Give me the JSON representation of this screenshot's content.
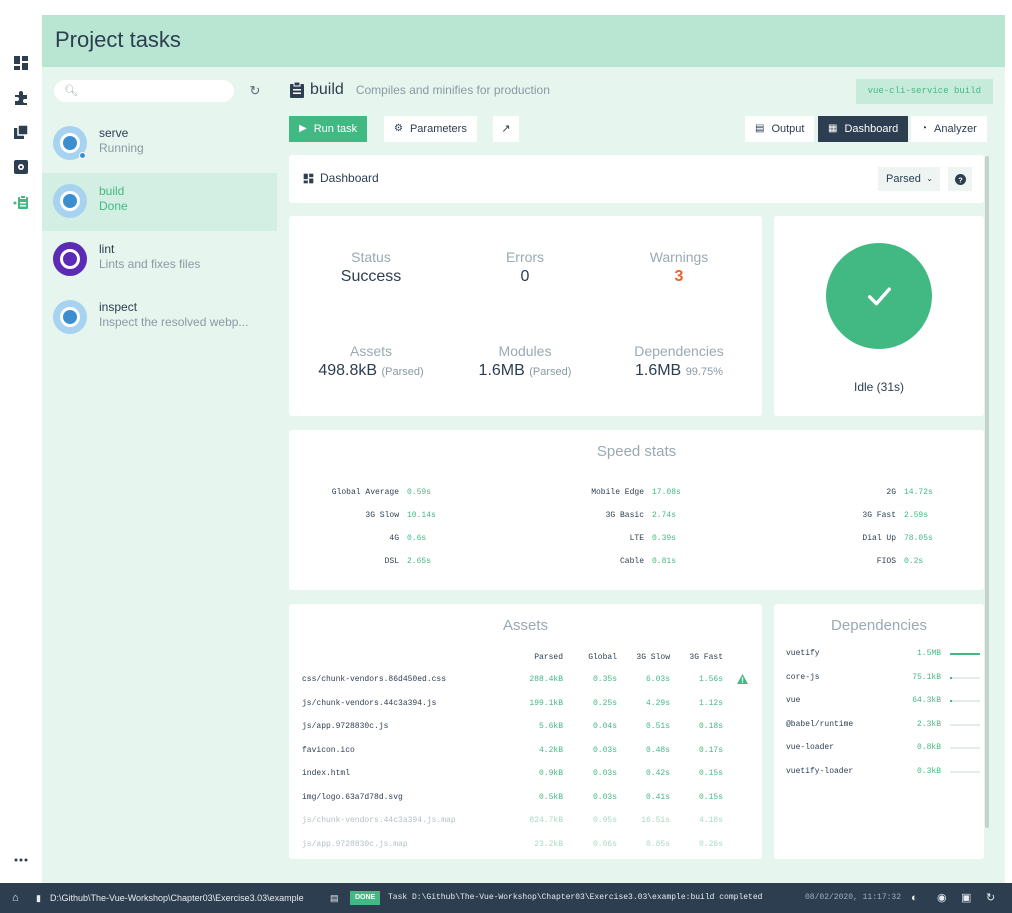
{
  "header": {
    "title": "Project tasks"
  },
  "search": {
    "placeholder": ""
  },
  "tasks": [
    {
      "name": "serve",
      "desc": "Running",
      "selected": false,
      "icon": "vue-cli-task-icon"
    },
    {
      "name": "build",
      "desc": "Done",
      "selected": true,
      "icon": "vue-cli-task-icon"
    },
    {
      "name": "lint",
      "desc": "Lints and fixes files",
      "selected": false,
      "icon": "eslint-icon"
    },
    {
      "name": "inspect",
      "desc": "Inspect the resolved webp...",
      "selected": false,
      "icon": "inspect-icon"
    }
  ],
  "task": {
    "title": "build",
    "description": "Compiles and minifies for production",
    "command": "vue-cli-service build"
  },
  "toolbar": {
    "run": "Run task",
    "parameters": "Parameters",
    "output": "Output",
    "dashboard": "Dashboard",
    "analyzer": "Analyzer"
  },
  "dashboard": {
    "label": "Dashboard",
    "select": "Parsed",
    "stats": {
      "status": {
        "label": "Status",
        "value": "Success"
      },
      "errors": {
        "label": "Errors",
        "value": "0"
      },
      "warnings": {
        "label": "Warnings",
        "value": "3"
      },
      "assets": {
        "label": "Assets",
        "value": "498.8kB",
        "note": "(Parsed)"
      },
      "modules": {
        "label": "Modules",
        "value": "1.6MB",
        "note": "(Parsed)"
      },
      "dependencies": {
        "label": "Dependencies",
        "value": "1.6MB",
        "note": "99.75%"
      }
    },
    "idle": "Idle (31s)"
  },
  "speed": {
    "title": "Speed stats",
    "rows": [
      [
        {
          "label": "Global Average",
          "value": "0.59s"
        },
        {
          "label": "Mobile Edge",
          "value": "17.08s"
        },
        {
          "label": "2G",
          "value": "14.72s"
        }
      ],
      [
        {
          "label": "3G Slow",
          "value": "10.14s"
        },
        {
          "label": "3G Basic",
          "value": "2.74s"
        },
        {
          "label": "3G Fast",
          "value": "2.59s"
        }
      ],
      [
        {
          "label": "4G",
          "value": "0.6s"
        },
        {
          "label": "LTE",
          "value": "0.39s"
        },
        {
          "label": "Dial Up",
          "value": "78.05s"
        }
      ],
      [
        {
          "label": "DSL",
          "value": "2.65s"
        },
        {
          "label": "Cable",
          "value": "0.81s"
        },
        {
          "label": "FIOS",
          "value": "0.2s"
        }
      ]
    ]
  },
  "assets": {
    "title": "Assets",
    "columns": [
      "Parsed",
      "Global",
      "3G Slow",
      "3G Fast"
    ],
    "rows": [
      {
        "name": "css/chunk-vendors.86d450ed.css",
        "parsed": "288.4kB",
        "global": "0.35s",
        "slow": "6.03s",
        "fast": "1.56s",
        "warn": true,
        "faded": false
      },
      {
        "name": "js/chunk-vendors.44c3a394.js",
        "parsed": "199.1kB",
        "global": "0.25s",
        "slow": "4.29s",
        "fast": "1.12s",
        "warn": false,
        "faded": false
      },
      {
        "name": "js/app.9728830c.js",
        "parsed": "5.6kB",
        "global": "0.04s",
        "slow": "0.51s",
        "fast": "0.18s",
        "warn": false,
        "faded": false
      },
      {
        "name": "favicon.ico",
        "parsed": "4.2kB",
        "global": "0.03s",
        "slow": "0.48s",
        "fast": "0.17s",
        "warn": false,
        "faded": false
      },
      {
        "name": "index.html",
        "parsed": "0.9kB",
        "global": "0.03s",
        "slow": "0.42s",
        "fast": "0.15s",
        "warn": false,
        "faded": false
      },
      {
        "name": "img/logo.63a7d78d.svg",
        "parsed": "0.5kB",
        "global": "0.03s",
        "slow": "0.41s",
        "fast": "0.15s",
        "warn": false,
        "faded": false
      },
      {
        "name": "js/chunk-vendors.44c3a394.js.map",
        "parsed": "824.7kB",
        "global": "0.95s",
        "slow": "16.51s",
        "fast": "4.18s",
        "warn": false,
        "faded": true
      },
      {
        "name": "js/app.9728830c.js.map",
        "parsed": "23.2kB",
        "global": "0.06s",
        "slow": "0.85s",
        "fast": "0.26s",
        "warn": false,
        "faded": true
      }
    ]
  },
  "deps": {
    "title": "Dependencies",
    "rows": [
      {
        "name": "vuetify",
        "size": "1.5MB",
        "ratio": 1.0
      },
      {
        "name": "core-js",
        "size": "75.1kB",
        "ratio": 0.05
      },
      {
        "name": "vue",
        "size": "64.3kB",
        "ratio": 0.04
      },
      {
        "name": "@babel/runtime",
        "size": "2.3kB",
        "ratio": 0.0
      },
      {
        "name": "vue-loader",
        "size": "0.8kB",
        "ratio": 0.0
      },
      {
        "name": "vuetify-loader",
        "size": "0.3kB",
        "ratio": 0.0
      }
    ]
  },
  "statusbar": {
    "path": "D:\\Github\\The-Vue-Workshop\\Chapter03\\Exercise3.03\\example",
    "badge": "DONE",
    "message": "Task D:\\Github\\The-Vue-Workshop\\Chapter03\\Exercise3.03\\example:build completed",
    "time": "08/02/2020, 11:17:32"
  },
  "colors": {
    "accent": "#42b983",
    "header": "#b9e6d2",
    "panel": "#e6f5ee",
    "warning": "#e8632c",
    "statusbar": "#2c3e50"
  }
}
